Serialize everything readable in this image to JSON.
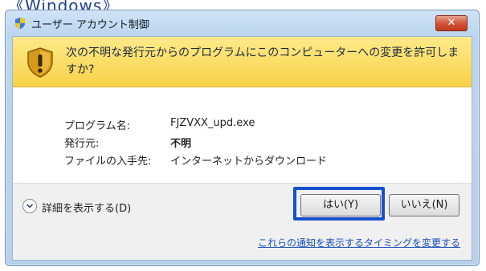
{
  "page_fragment": "《Windows》",
  "dialog": {
    "title": "ユーザー アカウント制御",
    "close_label": "✕",
    "question": "次の不明な発行元からのプログラムにこのコンピューターへの変更を許可しますか?",
    "details": [
      {
        "label": "プログラム名:",
        "value": "FJZVXX_upd.exe"
      },
      {
        "label": "発行元:",
        "value": "不明"
      },
      {
        "label": "ファイルの入手先:",
        "value": "インターネットからダウンロード"
      }
    ],
    "show_details_label": "詳細を表示する(D)",
    "yes_label": "はい(Y)",
    "no_label": "いいえ(N)",
    "timing_link": "これらの通知を表示するタイミングを変更する"
  },
  "icons": {
    "title": "uac-shield-icon",
    "warning": "warning-shield-icon",
    "expand": "chevron-down-icon"
  },
  "colors": {
    "banner": "#f8d247",
    "highlight": "#1450cf",
    "close": "#d2553a",
    "link": "#1a4fbd"
  }
}
